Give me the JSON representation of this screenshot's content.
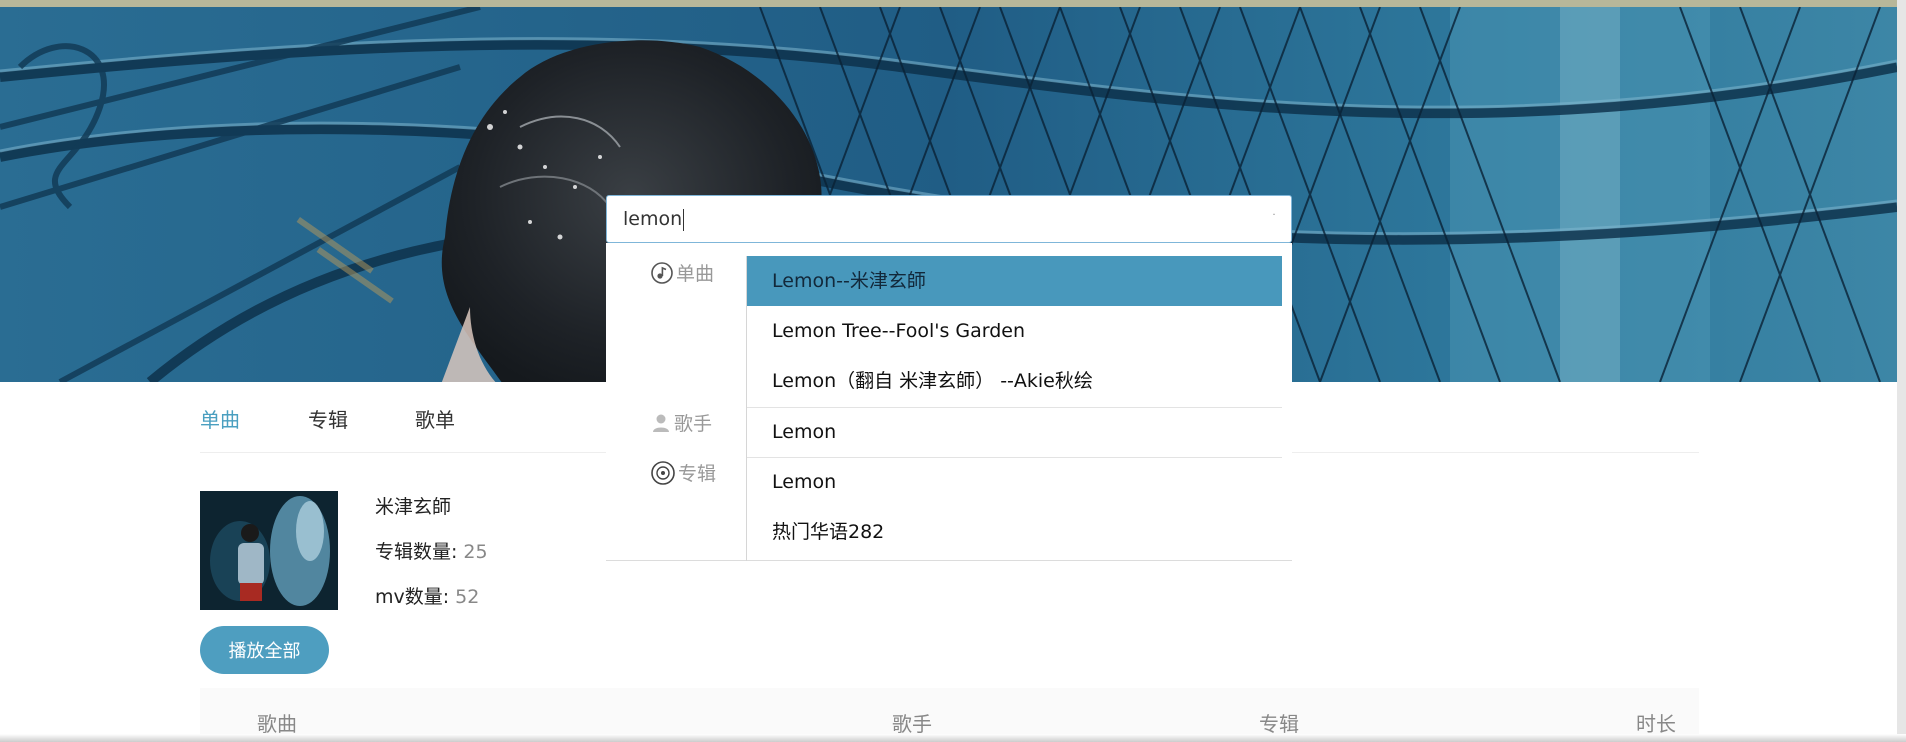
{
  "search": {
    "value": "lemon"
  },
  "suggestions": {
    "groups": [
      {
        "label": "单曲",
        "icon": "music-note-icon"
      },
      {
        "label": "歌手",
        "icon": "person-icon"
      },
      {
        "label": "专辑",
        "icon": "disc-icon"
      }
    ],
    "items": [
      {
        "label": "Lemon--米津玄師",
        "group": "单曲",
        "active": true
      },
      {
        "label": "Lemon Tree--Fool's Garden",
        "group": "单曲"
      },
      {
        "label": "Lemon（翻自 米津玄師） --Akie秋绘",
        "group": "单曲"
      },
      {
        "label": "Lemon",
        "group": "歌手"
      },
      {
        "label": "Lemon",
        "group": "专辑"
      },
      {
        "label": "热门华语282",
        "group": "专辑"
      }
    ]
  },
  "tabs": [
    {
      "label": "单曲",
      "active": true
    },
    {
      "label": "专辑"
    },
    {
      "label": "歌单"
    }
  ],
  "artist": {
    "name": "米津玄師",
    "album_count_label": "专辑数量:",
    "album_count": "25",
    "mv_count_label": "mv数量:",
    "mv_count": "52"
  },
  "play_all_label": "播放全部",
  "table_headers": {
    "song": "歌曲",
    "singer": "歌手",
    "album": "专辑",
    "duration": "时长"
  },
  "colors": {
    "accent": "#4a9fc0",
    "suggestion_active": "#4898bc",
    "button": "#4e9ec0"
  }
}
